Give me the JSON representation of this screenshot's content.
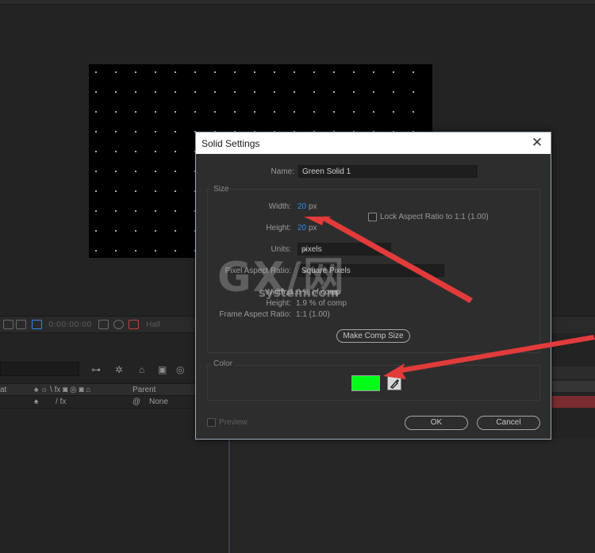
{
  "background": {
    "viewer": {
      "timecode": "0:00:00:00",
      "resolution": "Half"
    },
    "timeline": {
      "col_trackmatte": "at",
      "col_parent": "Parent",
      "row_parent": "None"
    }
  },
  "dialog": {
    "title": "Solid Settings",
    "close_glyph": "✕",
    "name_label": "Name:",
    "name_value": "Green Solid 1",
    "size_group": "Size",
    "width_label": "Width:",
    "width_value": "20",
    "width_unit": "px",
    "height_label": "Height:",
    "height_value": "20",
    "height_unit": "px",
    "lock_aspect_label": "Lock Aspect Ratio to 1:1 (1.00)",
    "units_label": "Units:",
    "units_value": "pixels",
    "pixel_aspect_label": "Pixel Aspect Ratio:",
    "pixel_aspect_value": "Square Pixels",
    "width_percent": "Width: 1.0 % of comp",
    "height_percent_label": "Height:",
    "height_percent": "1.9 % of comp",
    "frame_aspect_label": "Frame Aspect Ratio:",
    "frame_aspect_value": "1:1 (1.00)",
    "make_comp_size": "Make Comp Size",
    "color_group": "Color",
    "color_value": "#00ff17",
    "preview_label": "Preview",
    "ok_label": "OK",
    "cancel_label": "Cancel"
  },
  "watermark": {
    "logo": "GX/网",
    "domain": "system.com"
  },
  "colors": {
    "accent_blue": "#2d8ceb",
    "annotation_red": "#e83a3a",
    "swatch_green": "#00ff17"
  }
}
